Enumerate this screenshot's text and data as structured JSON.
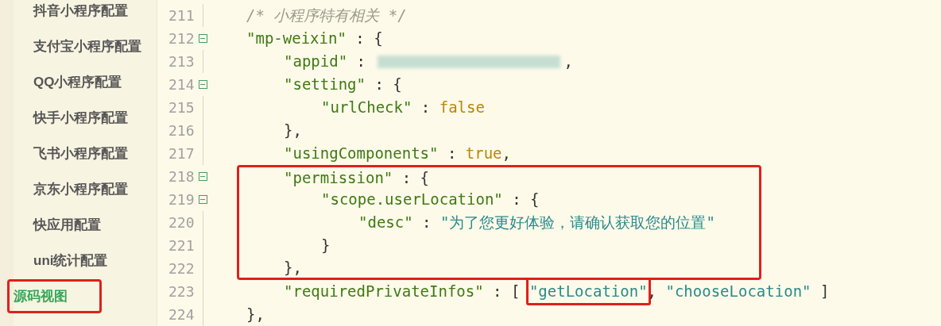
{
  "sidebar": {
    "items": [
      {
        "label": "抖音小程序配置",
        "selected": false,
        "highlighted": false
      },
      {
        "label": "支付宝小程序配置",
        "selected": false,
        "highlighted": false
      },
      {
        "label": "QQ小程序配置",
        "selected": false,
        "highlighted": false
      },
      {
        "label": "快手小程序配置",
        "selected": false,
        "highlighted": false
      },
      {
        "label": "飞书小程序配置",
        "selected": false,
        "highlighted": false
      },
      {
        "label": "京东小程序配置",
        "selected": false,
        "highlighted": false
      },
      {
        "label": "快应用配置",
        "selected": false,
        "highlighted": false
      },
      {
        "label": "uni统计配置",
        "selected": false,
        "highlighted": false
      },
      {
        "label": "源码视图",
        "selected": true,
        "highlighted": true
      }
    ]
  },
  "editor": {
    "lines": [
      {
        "number": "211",
        "foldable": false,
        "highlighted": false,
        "tokens": [
          {
            "kind": "comment",
            "text": "/* 小程序特有相关 */"
          }
        ]
      },
      {
        "number": "212",
        "foldable": true,
        "highlighted": false,
        "tokens": [
          {
            "kind": "key",
            "text": "\"mp-weixin\""
          },
          {
            "kind": "punct",
            "text": " : {"
          }
        ],
        "children": [
          {
            "number": "213",
            "foldable": false,
            "highlighted": false,
            "tokens": [
              {
                "kind": "key",
                "text": "\"appid\""
              },
              {
                "kind": "punct",
                "text": " : "
              },
              {
                "kind": "redacted"
              },
              {
                "kind": "punct",
                "text": ","
              }
            ]
          },
          {
            "number": "214",
            "foldable": true,
            "highlighted": false,
            "tokens": [
              {
                "kind": "key",
                "text": "\"setting\""
              },
              {
                "kind": "punct",
                "text": " : {"
              }
            ],
            "children": [
              {
                "number": "215",
                "foldable": false,
                "highlighted": false,
                "tokens": [
                  {
                    "kind": "key",
                    "text": "\"urlCheck\""
                  },
                  {
                    "kind": "punct",
                    "text": " : "
                  },
                  {
                    "kind": "literal",
                    "text": "false"
                  }
                ]
              }
            ]
          },
          {
            "number": "216",
            "foldable": false,
            "highlighted": false,
            "tokens": [
              {
                "kind": "punct",
                "text": "},"
              }
            ]
          },
          {
            "number": "217",
            "foldable": false,
            "highlighted": false,
            "tokens": [
              {
                "kind": "key",
                "text": "\"usingComponents\""
              },
              {
                "kind": "punct",
                "text": " : "
              },
              {
                "kind": "literal",
                "text": "true"
              },
              {
                "kind": "punct",
                "text": ","
              }
            ]
          },
          {
            "number": "218",
            "foldable": true,
            "highlighted": true,
            "tokens": [
              {
                "kind": "key",
                "text": "\"permission\""
              },
              {
                "kind": "punct",
                "text": " : {"
              }
            ],
            "children": [
              {
                "number": "219",
                "foldable": true,
                "highlighted": true,
                "tokens": [
                  {
                    "kind": "key",
                    "text": "\"scope.userLocation\""
                  },
                  {
                    "kind": "punct",
                    "text": " : {"
                  }
                ],
                "children": [
                  {
                    "number": "220",
                    "foldable": false,
                    "highlighted": true,
                    "tokens": [
                      {
                        "kind": "key",
                        "text": "\"desc\""
                      },
                      {
                        "kind": "punct",
                        "text": " : "
                      },
                      {
                        "kind": "string",
                        "text": "\"为了您更好体验，请确认获取您的位置\""
                      }
                    ]
                  }
                ]
              },
              {
                "number": "221",
                "foldable": false,
                "highlighted": true,
                "tokens": [
                  {
                    "kind": "punct",
                    "text": "}"
                  }
                ]
              }
            ]
          },
          {
            "number": "222",
            "foldable": false,
            "highlighted": true,
            "tokens": [
              {
                "kind": "punct",
                "text": "},"
              }
            ]
          },
          {
            "number": "223",
            "foldable": false,
            "highlighted": false,
            "tokens": [
              {
                "kind": "key",
                "text": "\"requiredPrivateInfos\""
              },
              {
                "kind": "punct",
                "text": " : [ "
              },
              {
                "kind": "string",
                "text": "\"getLocation\"",
                "highlighted": true
              },
              {
                "kind": "punct",
                "text": ", "
              },
              {
                "kind": "string",
                "text": "\"chooseLocation\"",
                "highlighted": false
              },
              {
                "kind": "punct",
                "text": " ]"
              }
            ]
          }
        ]
      },
      {
        "number": "224",
        "foldable": false,
        "highlighted": false,
        "tokens": [
          {
            "kind": "punct",
            "text": "},"
          }
        ]
      }
    ]
  }
}
